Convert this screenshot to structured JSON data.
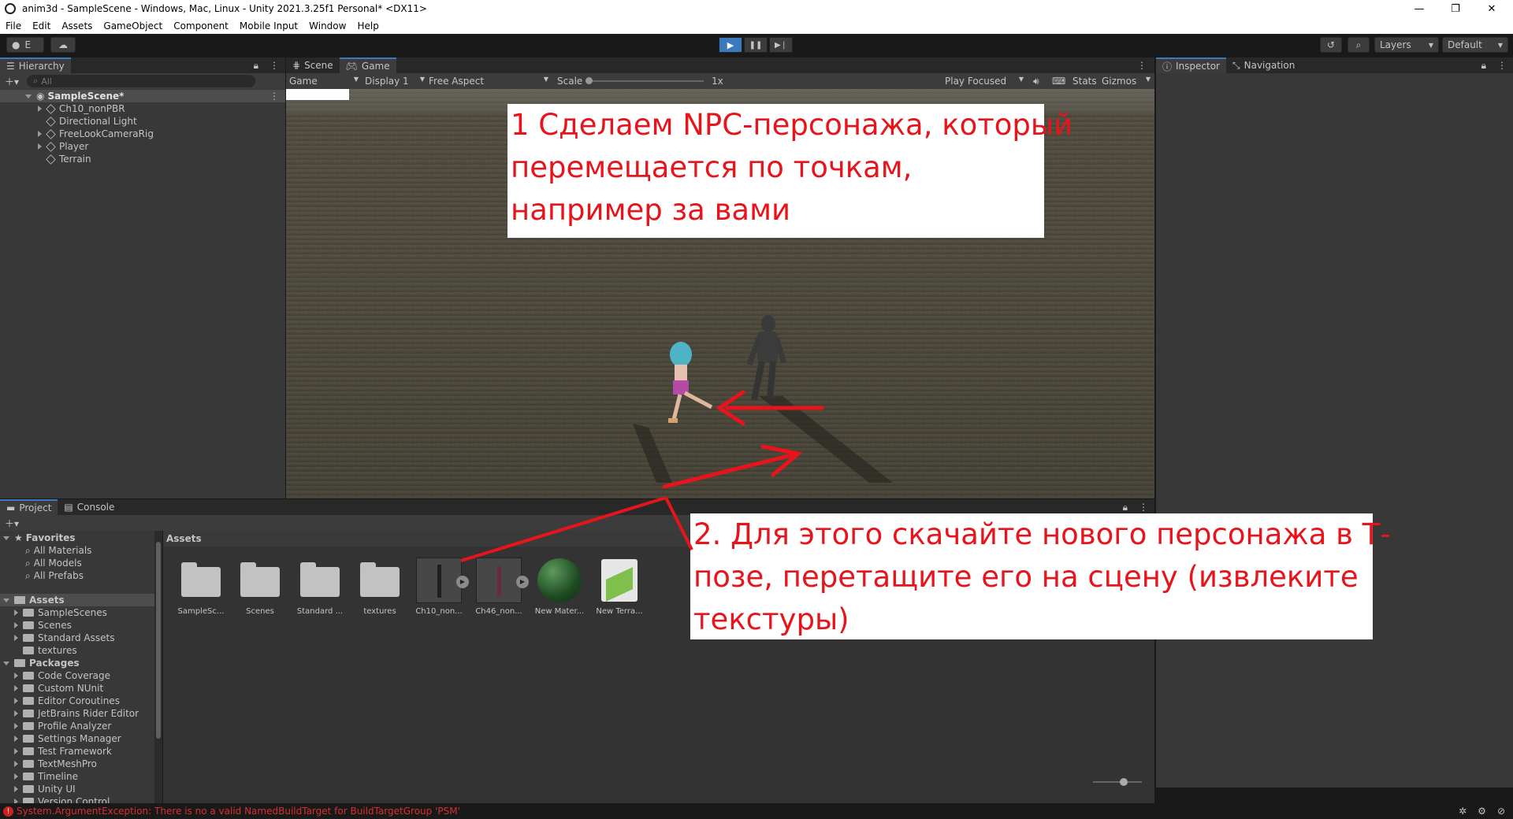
{
  "window": {
    "title": "anim3d - SampleScene - Windows, Mac, Linux - Unity 2021.3.25f1 Personal* <DX11>"
  },
  "menu": [
    "File",
    "Edit",
    "Assets",
    "GameObject",
    "Component",
    "Mobile Input",
    "Window",
    "Help"
  ],
  "toolbar": {
    "account_label": "E",
    "layers_label": "Layers",
    "layout_label": "Default"
  },
  "hierarchy": {
    "tab": "Hierarchy",
    "search_placeholder": "All",
    "scene": "SampleScene*",
    "items": [
      "Ch10_nonPBR",
      "Directional Light",
      "FreeLookCameraRig",
      "Player",
      "Terrain"
    ]
  },
  "game_view": {
    "tabs": [
      "Scene",
      "Game"
    ],
    "mode": "Game",
    "display": "Display 1",
    "aspect": "Free Aspect",
    "scale_label": "Scale",
    "scale_value": "1x",
    "play_focused": "Play Focused",
    "stats": "Stats",
    "gizmos": "Gizmos"
  },
  "inspector": {
    "tabs": [
      "Inspector",
      "Navigation"
    ]
  },
  "project": {
    "tabs": [
      "Project",
      "Console"
    ],
    "favorites_label": "Favorites",
    "favorites": [
      "All Materials",
      "All Models",
      "All Prefabs"
    ],
    "assets_label": "Assets",
    "assets_folders": [
      "SampleScenes",
      "Scenes",
      "Standard Assets",
      "textures"
    ],
    "packages_label": "Packages",
    "packages": [
      "Code Coverage",
      "Custom NUnit",
      "Editor Coroutines",
      "JetBrains Rider Editor",
      "Profile Analyzer",
      "Settings Manager",
      "Test Framework",
      "TextMeshPro",
      "Timeline",
      "Unity UI",
      "Version Control"
    ],
    "breadcrumb": "Assets",
    "grid_items": [
      {
        "label": "SampleSc...",
        "kind": "folder"
      },
      {
        "label": "Scenes",
        "kind": "folder"
      },
      {
        "label": "Standard ...",
        "kind": "folder"
      },
      {
        "label": "textures",
        "kind": "folder"
      },
      {
        "label": "Ch10_non...",
        "kind": "model"
      },
      {
        "label": "Ch46_non...",
        "kind": "model"
      },
      {
        "label": "New Mater...",
        "kind": "material"
      },
      {
        "label": "New Terra...",
        "kind": "terrain"
      }
    ]
  },
  "annotations": {
    "first": [
      "1 Сделаем NPC-персонажа, который",
      "перемещается по точкам,",
      "например за вами"
    ],
    "second": [
      "2. Для этого скачайте нового персонажа в Т-",
      "позе, перетащите его на сцену (извлеките",
      "текстуры)"
    ],
    "color": "#e8141c"
  },
  "status": {
    "error": "System.ArgumentException: There is no a valid NamedBuildTarget for BuildTargetGroup 'PSM'"
  },
  "colors": {
    "editor_bg": "#383838",
    "header_bg": "#282828",
    "accent": "#3a79bb"
  }
}
